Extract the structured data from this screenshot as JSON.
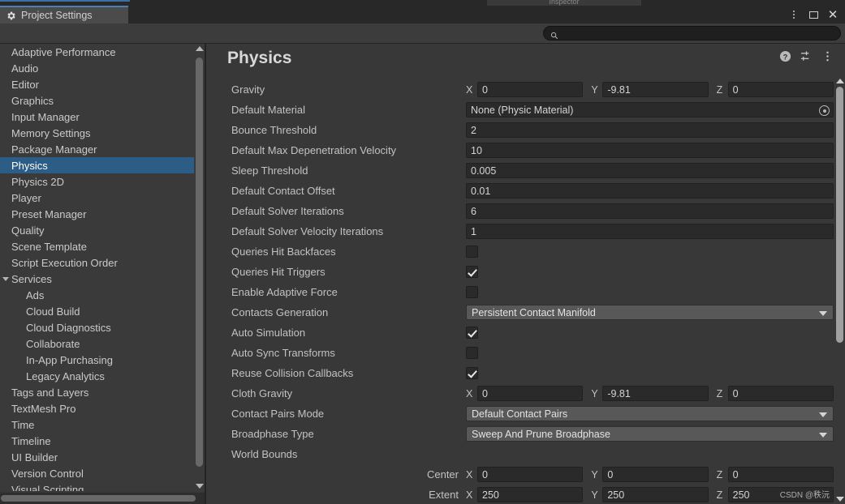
{
  "window": {
    "tab_title": "Project Settings",
    "gear_icon": "gear-icon",
    "kebab_label": "⋮",
    "restore_label": "□",
    "close_label": "✕",
    "ghost_tab_label": "Inspector",
    "accent_color": "#4a80b5"
  },
  "search": {
    "value": "",
    "placeholder": "",
    "icon": "search-icon"
  },
  "sidebar": {
    "items": [
      {
        "label": "Adaptive Performance",
        "indent": false,
        "selected": false,
        "arrow": false
      },
      {
        "label": "Audio",
        "indent": false,
        "selected": false,
        "arrow": false
      },
      {
        "label": "Editor",
        "indent": false,
        "selected": false,
        "arrow": false
      },
      {
        "label": "Graphics",
        "indent": false,
        "selected": false,
        "arrow": false
      },
      {
        "label": "Input Manager",
        "indent": false,
        "selected": false,
        "arrow": false
      },
      {
        "label": "Memory Settings",
        "indent": false,
        "selected": false,
        "arrow": false
      },
      {
        "label": "Package Manager",
        "indent": false,
        "selected": false,
        "arrow": false
      },
      {
        "label": "Physics",
        "indent": false,
        "selected": true,
        "arrow": false
      },
      {
        "label": "Physics 2D",
        "indent": false,
        "selected": false,
        "arrow": false
      },
      {
        "label": "Player",
        "indent": false,
        "selected": false,
        "arrow": false
      },
      {
        "label": "Preset Manager",
        "indent": false,
        "selected": false,
        "arrow": false
      },
      {
        "label": "Quality",
        "indent": false,
        "selected": false,
        "arrow": false
      },
      {
        "label": "Scene Template",
        "indent": false,
        "selected": false,
        "arrow": false
      },
      {
        "label": "Script Execution Order",
        "indent": false,
        "selected": false,
        "arrow": false
      },
      {
        "label": "Services",
        "indent": false,
        "selected": false,
        "arrow": true
      },
      {
        "label": "Ads",
        "indent": true,
        "selected": false,
        "arrow": false
      },
      {
        "label": "Cloud Build",
        "indent": true,
        "selected": false,
        "arrow": false
      },
      {
        "label": "Cloud Diagnostics",
        "indent": true,
        "selected": false,
        "arrow": false
      },
      {
        "label": "Collaborate",
        "indent": true,
        "selected": false,
        "arrow": false
      },
      {
        "label": "In-App Purchasing",
        "indent": true,
        "selected": false,
        "arrow": false
      },
      {
        "label": "Legacy Analytics",
        "indent": true,
        "selected": false,
        "arrow": false
      },
      {
        "label": "Tags and Layers",
        "indent": false,
        "selected": false,
        "arrow": false
      },
      {
        "label": "TextMesh Pro",
        "indent": false,
        "selected": false,
        "arrow": false
      },
      {
        "label": "Time",
        "indent": false,
        "selected": false,
        "arrow": false
      },
      {
        "label": "Timeline",
        "indent": false,
        "selected": false,
        "arrow": false
      },
      {
        "label": "UI Builder",
        "indent": false,
        "selected": false,
        "arrow": false
      },
      {
        "label": "Version Control",
        "indent": false,
        "selected": false,
        "arrow": false
      },
      {
        "label": "Visual Scripting",
        "indent": false,
        "selected": false,
        "arrow": false
      }
    ],
    "selection_color": "#2c5d87"
  },
  "main": {
    "title": "Physics",
    "header_icons": [
      "help-icon",
      "preset-icon",
      "kebab-menu-icon"
    ],
    "rows": [
      {
        "label": "Gravity",
        "type": "vector3",
        "axes": [
          {
            "axis": "X",
            "value": "0"
          },
          {
            "axis": "Y",
            "value": "-9.81"
          },
          {
            "axis": "Z",
            "value": "0"
          }
        ]
      },
      {
        "label": "Default Material",
        "type": "object",
        "value": "None (Physic Material)"
      },
      {
        "label": "Bounce Threshold",
        "type": "text",
        "value": "2"
      },
      {
        "label": "Default Max Depenetration Velocity",
        "type": "text",
        "value": "10"
      },
      {
        "label": "Sleep Threshold",
        "type": "text",
        "value": "0.005"
      },
      {
        "label": "Default Contact Offset",
        "type": "text",
        "value": "0.01"
      },
      {
        "label": "Default Solver Iterations",
        "type": "text",
        "value": "6"
      },
      {
        "label": "Default Solver Velocity Iterations",
        "type": "text",
        "value": "1"
      },
      {
        "label": "Queries Hit Backfaces",
        "type": "checkbox",
        "checked": false
      },
      {
        "label": "Queries Hit Triggers",
        "type": "checkbox",
        "checked": true
      },
      {
        "label": "Enable Adaptive Force",
        "type": "checkbox",
        "checked": false
      },
      {
        "label": "Contacts Generation",
        "type": "dropdown",
        "value": "Persistent Contact Manifold"
      },
      {
        "label": "Auto Simulation",
        "type": "checkbox",
        "checked": true
      },
      {
        "label": "Auto Sync Transforms",
        "type": "checkbox",
        "checked": false
      },
      {
        "label": "Reuse Collision Callbacks",
        "type": "checkbox",
        "checked": true
      },
      {
        "label": "Cloth Gravity",
        "type": "vector3",
        "axes": [
          {
            "axis": "X",
            "value": "0"
          },
          {
            "axis": "Y",
            "value": "-9.81"
          },
          {
            "axis": "Z",
            "value": "0"
          }
        ]
      },
      {
        "label": "Contact Pairs Mode",
        "type": "dropdown",
        "value": "Default Contact Pairs"
      },
      {
        "label": "Broadphase Type",
        "type": "dropdown",
        "value": "Sweep And Prune Broadphase"
      },
      {
        "label": "World Bounds",
        "type": "header"
      },
      {
        "label": "Center",
        "type": "vector3",
        "sub": true,
        "axes": [
          {
            "axis": "X",
            "value": "0"
          },
          {
            "axis": "Y",
            "value": "0"
          },
          {
            "axis": "Z",
            "value": "0"
          }
        ]
      },
      {
        "label": "Extent",
        "type": "vector3",
        "sub": true,
        "axes": [
          {
            "axis": "X",
            "value": "250"
          },
          {
            "axis": "Y",
            "value": "250"
          },
          {
            "axis": "Z",
            "value": "250"
          }
        ]
      }
    ]
  },
  "watermark": {
    "text": "CSDN @秩沅"
  }
}
